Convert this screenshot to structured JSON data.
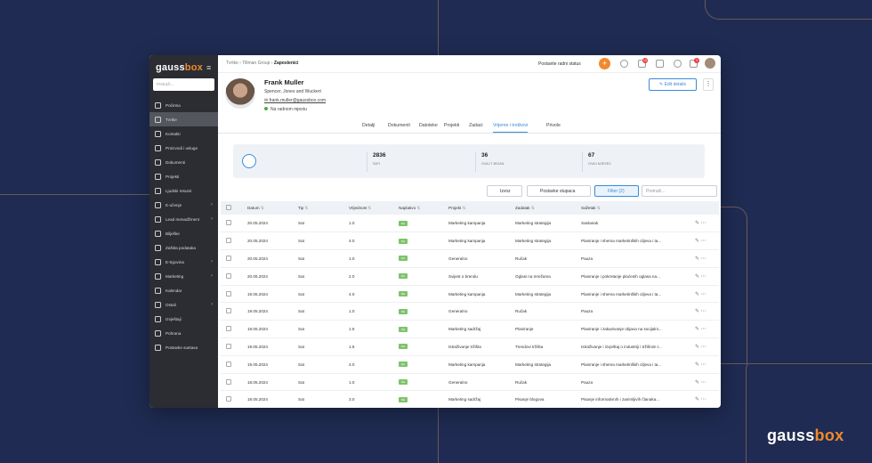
{
  "app": {
    "logo_main": "gauss",
    "logo_accent": "box",
    "search_placeholder": "Pretraži...",
    "brand_main": "gauss",
    "brand_accent": "box"
  },
  "sidebar": {
    "items": [
      {
        "label": "Početna",
        "chev": false
      },
      {
        "label": "Tvrtke",
        "chev": false,
        "active": true
      },
      {
        "label": "Kontakti",
        "chev": false
      },
      {
        "label": "Proizvodi i usluge",
        "chev": false
      },
      {
        "label": "Dokumenti",
        "chev": false
      },
      {
        "label": "Projekti",
        "chev": false
      },
      {
        "label": "Ljudski resursi",
        "chev": false
      },
      {
        "label": "E-učenje",
        "chev": true
      },
      {
        "label": "Lead menadžment",
        "chev": true
      },
      {
        "label": "Bilješke",
        "chev": false
      },
      {
        "label": "Zaštita podataka",
        "chev": false
      },
      {
        "label": "E-trgovina",
        "chev": true
      },
      {
        "label": "Marketing",
        "chev": true
      },
      {
        "label": "Kalendar",
        "chev": false
      },
      {
        "label": "Ostali",
        "chev": true
      },
      {
        "label": "Izvještaji",
        "chev": false
      },
      {
        "label": "Pohrana",
        "chev": false
      },
      {
        "label": "Postavke sustava",
        "chev": false
      }
    ]
  },
  "header": {
    "crumb1": "Tvrtke",
    "crumb2": "Tillman Group",
    "crumb3": "Zaposlenici",
    "status": "Postavite radni status",
    "badge1": "10",
    "badge2": "3"
  },
  "profile": {
    "name": "Frank Muller",
    "company": "Spencer, Jones and Wuckert",
    "email": "frank.muller@gaussbox.com",
    "status": "Na radnom mjestu",
    "edit": "Edit details"
  },
  "tabs": [
    "Detalji",
    "Dokumenti",
    "Datoteke",
    "Projekti",
    "Zadaci",
    "Vrijeme i troškovi",
    "Privole"
  ],
  "stats": [
    {
      "value": "2836",
      "label": "SATI"
    },
    {
      "value": "36",
      "label": "OVAJ TJEDAN"
    },
    {
      "value": "67",
      "label": "OVAJ MJESEC"
    }
  ],
  "toolbar": {
    "export": "Izvoz",
    "columns": "Postavke stupaca",
    "filter": "Filter (2)",
    "search": "Pretraži..."
  },
  "table": {
    "headers": [
      "Datum",
      "Tip",
      "Vrijednost",
      "Naplativo",
      "Projekt",
      "Zadatak",
      "Sažetak"
    ],
    "rows": [
      [
        "20.05.2024",
        "Sat",
        "1.0",
        "DA",
        "Marketing kampanja",
        "Marketing strategija",
        "Sastanak"
      ],
      [
        "20.05.2024",
        "Sat",
        "4.0",
        "DA",
        "Marketing kampanja",
        "Marketing strategija",
        "Planiranje i shema marketinških ciljeva i ta..."
      ],
      [
        "20.05.2024",
        "Sat",
        "1.0",
        "DA",
        "Generalno",
        "Ručak",
        "Pauza"
      ],
      [
        "20.05.2024",
        "Sat",
        "2.0",
        "DA",
        "Svijest o brendu",
        "Oglasi na mrežama",
        "Planiranje i pokretanje plaćenih oglasa na..."
      ],
      [
        "19.05.2024",
        "Sat",
        "4.0",
        "NE",
        "Marketing kampanja",
        "Marketing strategija",
        "Planiranje i shema marketinških ciljeva i ta..."
      ],
      [
        "19.05.2024",
        "Sat",
        "1.0",
        "NE",
        "Generalno",
        "Ručak",
        "Pauza"
      ],
      [
        "19.05.2024",
        "Sat",
        "1.5",
        "NE",
        "Marketing sadržaj",
        "Planiranje",
        "Planiranje i zakazivanje objava na socijalni..."
      ],
      [
        "19.05.2024",
        "Sat",
        "1.5",
        "DA",
        "Istraživanje tržišta",
        "Trendovi tržišta",
        "Istraživanje i izvještaj o industriji i tržišnim t..."
      ],
      [
        "19.05.2024",
        "Sat",
        "4.0",
        "DA",
        "Marketing kampanja",
        "Marketing strategija",
        "Planiranje i shema marketinških ciljeva i ta..."
      ],
      [
        "18.05.2024",
        "Sat",
        "1.0",
        "NE",
        "Generalno",
        "Ručak",
        "Pauza"
      ],
      [
        "18.05.2024",
        "Sat",
        "3.0",
        "NE",
        "Marketing sadržaj",
        "Pisanje blogova",
        "Pisanje informativnih i zanimljivih članaka..."
      ]
    ]
  }
}
